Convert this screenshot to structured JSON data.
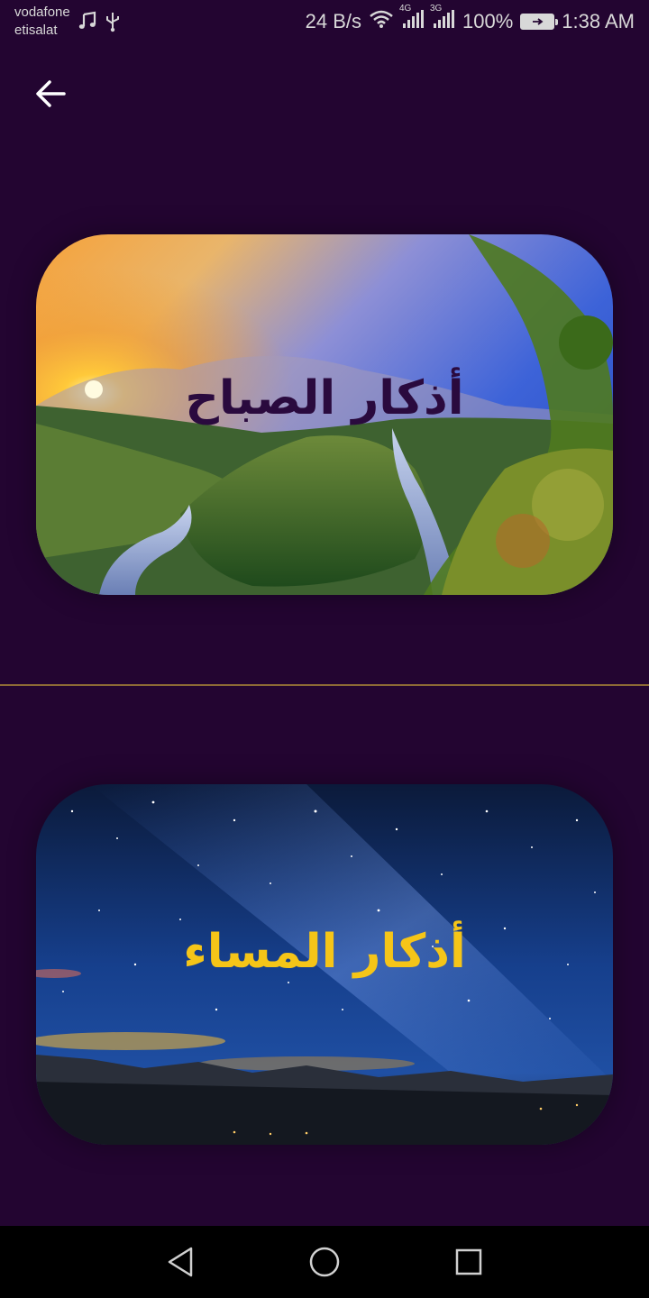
{
  "status_bar": {
    "carrier_1": "vodafone",
    "carrier_2": "etisalat",
    "network_speed": "24 B/s",
    "network_1": "4G",
    "network_2": "3G",
    "battery": "100%",
    "time": "1:38 AM",
    "icons": [
      "music-icon",
      "usb-icon",
      "wifi-icon",
      "signal-icon",
      "signal-icon",
      "battery-charging-icon"
    ]
  },
  "app_bar": {
    "back_icon": "arrow-back-icon"
  },
  "cards": {
    "morning": {
      "title": "أذكار الصباح",
      "title_color": "#2a0a3e",
      "image": "sunrise-river-landscape"
    },
    "evening": {
      "title": "أذكار المساء",
      "title_color": "#f5c518",
      "image": "night-sky-milky-way"
    }
  },
  "colors": {
    "background": "#230531",
    "divider": "#8c6a35",
    "nav_bar": "#000000"
  },
  "nav_bar": {
    "icons": [
      "back-triangle-icon",
      "home-circle-icon",
      "recents-square-icon"
    ]
  }
}
